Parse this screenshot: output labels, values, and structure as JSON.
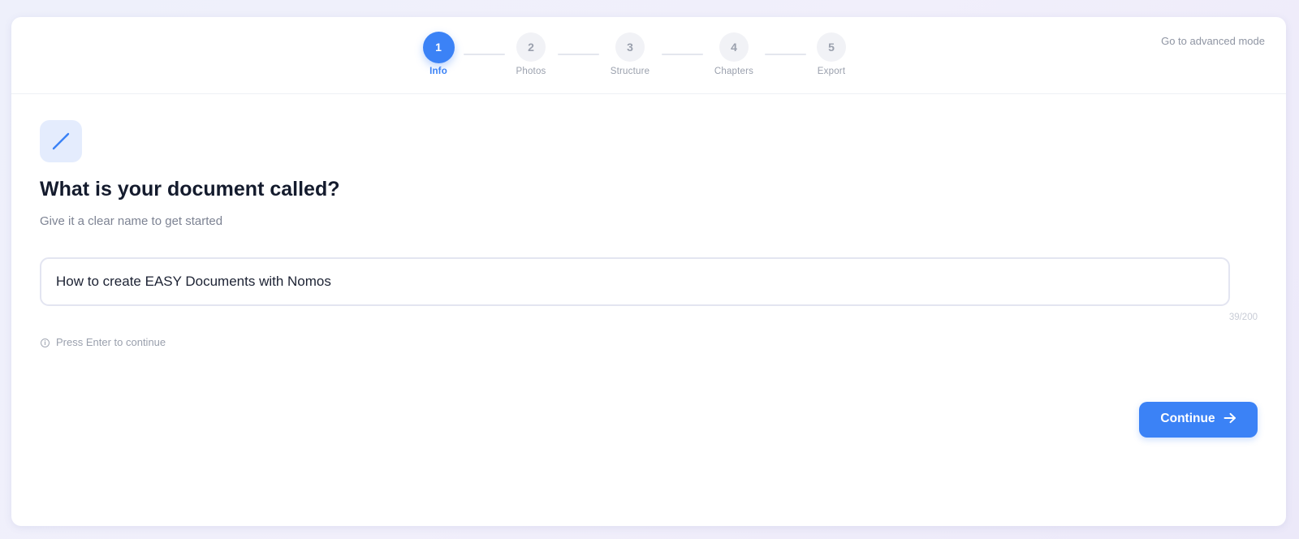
{
  "wizard": {
    "steps": [
      {
        "number": "1",
        "label": "Info",
        "active": true
      },
      {
        "number": "2",
        "label": "Photos",
        "active": false
      },
      {
        "number": "3",
        "label": "Structure",
        "active": false
      },
      {
        "number": "4",
        "label": "Chapters",
        "active": false
      },
      {
        "number": "5",
        "label": "Export",
        "active": false
      }
    ],
    "advanced_link": "Go to advanced mode"
  },
  "content": {
    "icon": "pencil-icon",
    "title": "What is your document called?",
    "subtitle": "Give it a clear name to get started",
    "input_value": "How to create EASY Documents with Nomos",
    "char_count": "39/200",
    "hint_icon": "info-icon",
    "hint": "Press Enter to continue",
    "continue_label": "Continue",
    "continue_icon": "arrow-right-icon"
  },
  "colors": {
    "accent": "#3b82f6",
    "background": "#eef0fb",
    "icon_tile": "#e4ecfd",
    "text_primary": "#141b2d",
    "text_muted": "#7d8393"
  }
}
